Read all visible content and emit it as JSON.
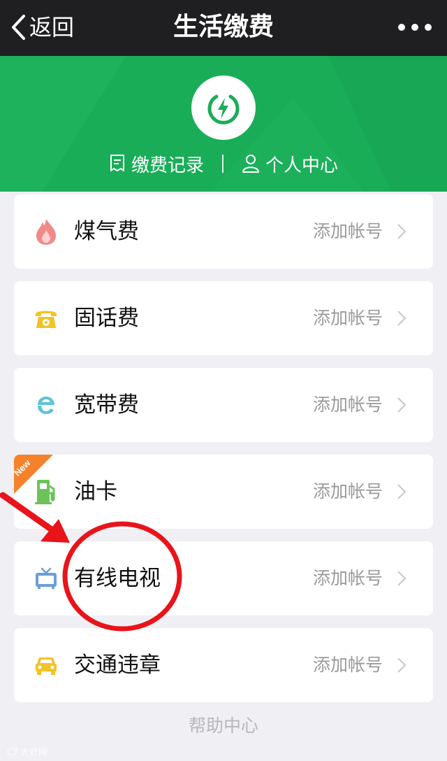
{
  "navbar": {
    "back_label": "返回",
    "title": "生活缴费"
  },
  "header": {
    "links": [
      {
        "label": "缴费记录",
        "icon": "receipt-icon"
      },
      {
        "label": "个人中心",
        "icon": "person-icon"
      }
    ],
    "logo_icon": "lightning-power-icon",
    "accent_color": "#1aad58"
  },
  "items": [
    {
      "title": "煤气费",
      "action": "添加帐号",
      "icon": "flame-icon"
    },
    {
      "title": "固话费",
      "action": "添加帐号",
      "icon": "telephone-icon"
    },
    {
      "title": "宽带费",
      "action": "添加帐号",
      "icon": "broadband-e-icon"
    },
    {
      "title": "油卡",
      "action": "添加帐号",
      "icon": "fuel-pump-icon",
      "badge": "New"
    },
    {
      "title": "有线电视",
      "action": "添加帐号",
      "icon": "tv-icon"
    },
    {
      "title": "交通违章",
      "action": "添加帐号",
      "icon": "car-icon"
    }
  ],
  "help_label": "帮助中心",
  "watermark": "大虾网",
  "colors": {
    "navbar_bg": "#1f1f21",
    "page_bg": "#efeff4",
    "annotation_red": "#e8141a",
    "badge_orange": "#f5822a"
  }
}
